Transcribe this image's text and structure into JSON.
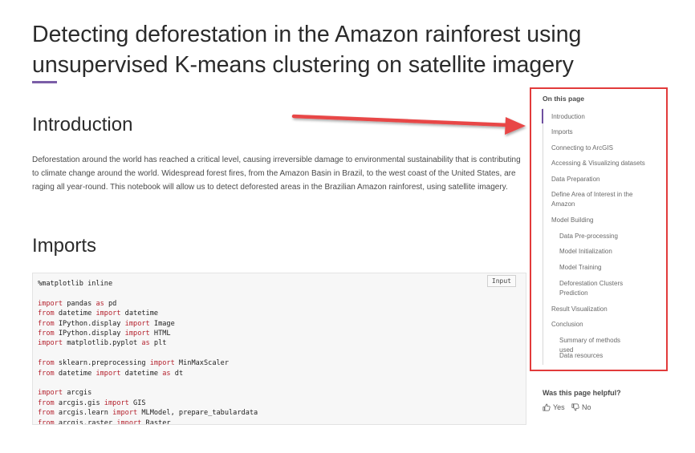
{
  "page": {
    "title": "Detecting deforestation in the Amazon rainforest using unsupervised K-means clustering on satellite imagery"
  },
  "intro": {
    "heading": "Introduction",
    "text": "Deforestation around the world has reached a critical level, causing irreversible damage to environmental sustainability that is contributing to climate change around the world. Widespread forest fires, from the Amazon Basin in Brazil, to the west coast of the United States, are raging all year-round. This notebook will allow us to detect deforested areas in the Brazilian Amazon rainforest, using satellite imagery."
  },
  "imports": {
    "heading": "Imports",
    "badge": "Input",
    "code_lines": [
      [
        {
          "t": "%matplotlib inline",
          "k": false
        }
      ],
      [],
      [
        {
          "t": "import",
          "k": true
        },
        {
          "t": " pandas ",
          "k": false
        },
        {
          "t": "as",
          "k": true
        },
        {
          "t": " pd",
          "k": false
        }
      ],
      [
        {
          "t": "from",
          "k": true
        },
        {
          "t": " datetime ",
          "k": false
        },
        {
          "t": "import",
          "k": true
        },
        {
          "t": " datetime",
          "k": false
        }
      ],
      [
        {
          "t": "from",
          "k": true
        },
        {
          "t": " IPython.display ",
          "k": false
        },
        {
          "t": "import",
          "k": true
        },
        {
          "t": " Image",
          "k": false
        }
      ],
      [
        {
          "t": "from",
          "k": true
        },
        {
          "t": " IPython.display ",
          "k": false
        },
        {
          "t": "import",
          "k": true
        },
        {
          "t": " HTML",
          "k": false
        }
      ],
      [
        {
          "t": "import",
          "k": true
        },
        {
          "t": " matplotlib.pyplot ",
          "k": false
        },
        {
          "t": "as",
          "k": true
        },
        {
          "t": " plt",
          "k": false
        }
      ],
      [],
      [
        {
          "t": "from",
          "k": true
        },
        {
          "t": " sklearn.preprocessing ",
          "k": false
        },
        {
          "t": "import",
          "k": true
        },
        {
          "t": " MinMaxScaler",
          "k": false
        }
      ],
      [
        {
          "t": "from",
          "k": true
        },
        {
          "t": " datetime ",
          "k": false
        },
        {
          "t": "import",
          "k": true
        },
        {
          "t": " datetime ",
          "k": false
        },
        {
          "t": "as",
          "k": true
        },
        {
          "t": " dt",
          "k": false
        }
      ],
      [],
      [
        {
          "t": "import",
          "k": true
        },
        {
          "t": " arcgis",
          "k": false
        }
      ],
      [
        {
          "t": "from",
          "k": true
        },
        {
          "t": " arcgis.gis ",
          "k": false
        },
        {
          "t": "import",
          "k": true
        },
        {
          "t": " GIS",
          "k": false
        }
      ],
      [
        {
          "t": "from",
          "k": true
        },
        {
          "t": " arcgis.learn ",
          "k": false
        },
        {
          "t": "import",
          "k": true
        },
        {
          "t": " MLModel, prepare_tabulardata",
          "k": false
        }
      ],
      [
        {
          "t": "from",
          "k": true
        },
        {
          "t": " arcgis.raster ",
          "k": false
        },
        {
          "t": "import",
          "k": true
        },
        {
          "t": " Raster",
          "k": false
        }
      ]
    ]
  },
  "toc": {
    "title": "On this page",
    "items": [
      {
        "label": "Introduction",
        "indent": false,
        "active": true
      },
      {
        "label": "Imports",
        "indent": false,
        "active": false
      },
      {
        "label": "Connecting to ArcGIS",
        "indent": false,
        "active": false
      },
      {
        "label": "Accessing & Visualizing datasets",
        "indent": false,
        "active": false
      },
      {
        "label": "Data Preparation",
        "indent": false,
        "active": false
      },
      {
        "label": "Define Area of Interest in the Amazon",
        "indent": false,
        "active": false
      },
      {
        "label": "Model Building",
        "indent": false,
        "active": false
      },
      {
        "label": "Data Pre-processing",
        "indent": true,
        "active": false
      },
      {
        "label": "Model Initialization",
        "indent": true,
        "active": false
      },
      {
        "label": "Model Training",
        "indent": true,
        "active": false
      },
      {
        "label": "Deforestation Clusters Prediction",
        "indent": true,
        "active": false
      },
      {
        "label": "Result Visualization",
        "indent": false,
        "active": false
      },
      {
        "label": "Conclusion",
        "indent": false,
        "active": false
      },
      {
        "label": "Summary of methods used",
        "indent": true,
        "active": false
      },
      {
        "label": "Data resources",
        "indent": true,
        "active": false
      }
    ]
  },
  "feedback": {
    "question": "Was this page helpful?",
    "yes": "Yes",
    "no": "No",
    "yes_icon": "thumbs-up-icon",
    "no_icon": "thumbs-down-icon"
  },
  "colors": {
    "accent": "#7b5ea7",
    "highlight": "#e23b3b",
    "keyword": "#b5232f"
  }
}
